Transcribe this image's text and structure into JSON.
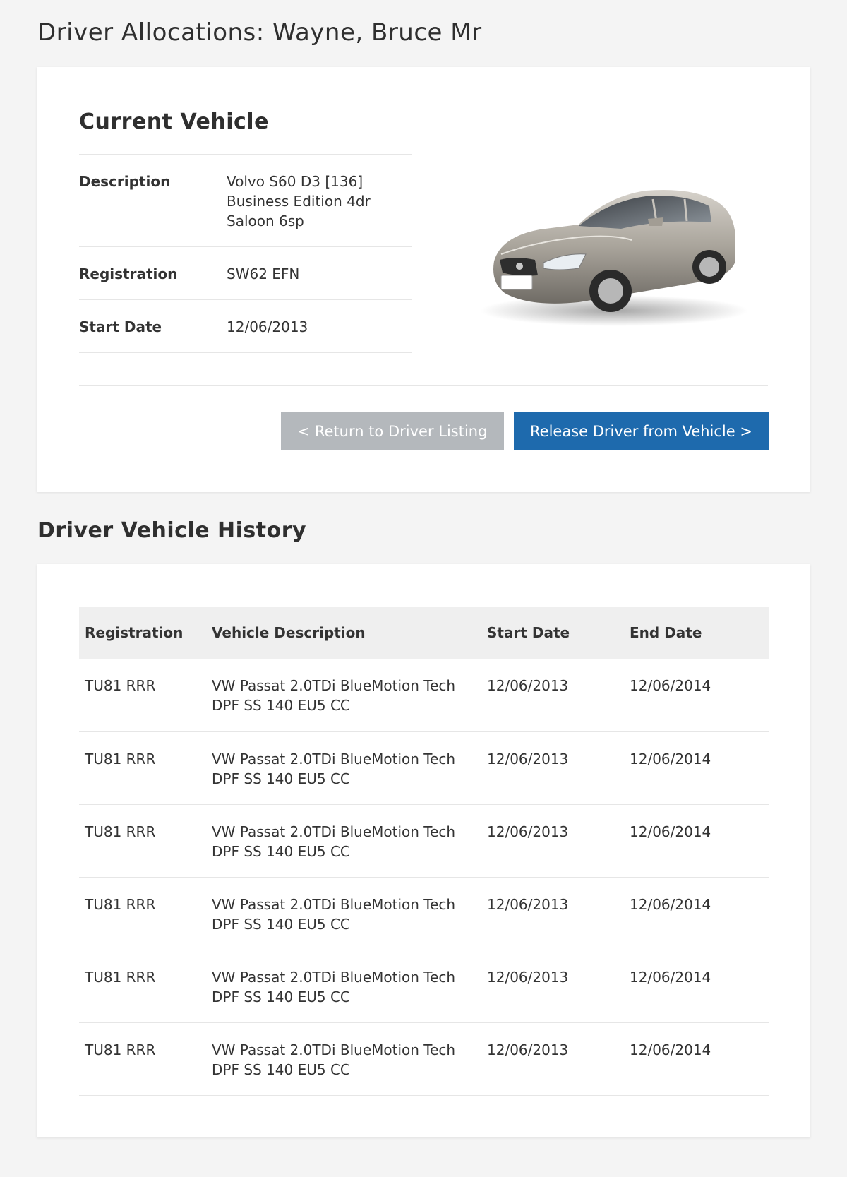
{
  "page": {
    "title": "Driver Allocations: Wayne, Bruce Mr"
  },
  "current_vehicle": {
    "title": "Current Vehicle",
    "details": [
      {
        "label": "Description",
        "value": "Volvo S60 D3 [136] Business Edition 4dr Saloon 6sp"
      },
      {
        "label": "Registration",
        "value": "SW62 EFN"
      },
      {
        "label": "Start Date",
        "value": "12/06/2013"
      }
    ],
    "image_alt": "silver-sedan-car-image",
    "return_button": "< Return to Driver Listing",
    "release_button": "Release Driver from Vehicle >"
  },
  "history": {
    "title": "Driver Vehicle History",
    "columns": [
      "Registration",
      "Vehicle Description",
      "Start Date",
      "End Date"
    ],
    "rows": [
      {
        "registration": "TU81 RRR",
        "description": "VW Passat 2.0TDi BlueMotion Tech DPF SS 140 EU5 CC",
        "start": "12/06/2013",
        "end": "12/06/2014"
      },
      {
        "registration": "TU81 RRR",
        "description": "VW Passat 2.0TDi BlueMotion Tech DPF SS 140 EU5 CC",
        "start": "12/06/2013",
        "end": "12/06/2014"
      },
      {
        "registration": "TU81 RRR",
        "description": "VW Passat 2.0TDi BlueMotion Tech DPF SS 140 EU5 CC",
        "start": "12/06/2013",
        "end": "12/06/2014"
      },
      {
        "registration": "TU81 RRR",
        "description": "VW Passat 2.0TDi BlueMotion Tech DPF SS 140 EU5 CC",
        "start": "12/06/2013",
        "end": "12/06/2014"
      },
      {
        "registration": "TU81 RRR",
        "description": "VW Passat 2.0TDi BlueMotion Tech DPF SS 140 EU5 CC",
        "start": "12/06/2013",
        "end": "12/06/2014"
      },
      {
        "registration": "TU81 RRR",
        "description": "VW Passat 2.0TDi BlueMotion Tech DPF SS 140 EU5 CC",
        "start": "12/06/2013",
        "end": "12/06/2014"
      }
    ]
  },
  "colors": {
    "background": "#f4f4f4",
    "card": "#ffffff",
    "primary_button": "#1e6aad",
    "secondary_button": "#b4b8bc",
    "table_header": "#efefef"
  }
}
